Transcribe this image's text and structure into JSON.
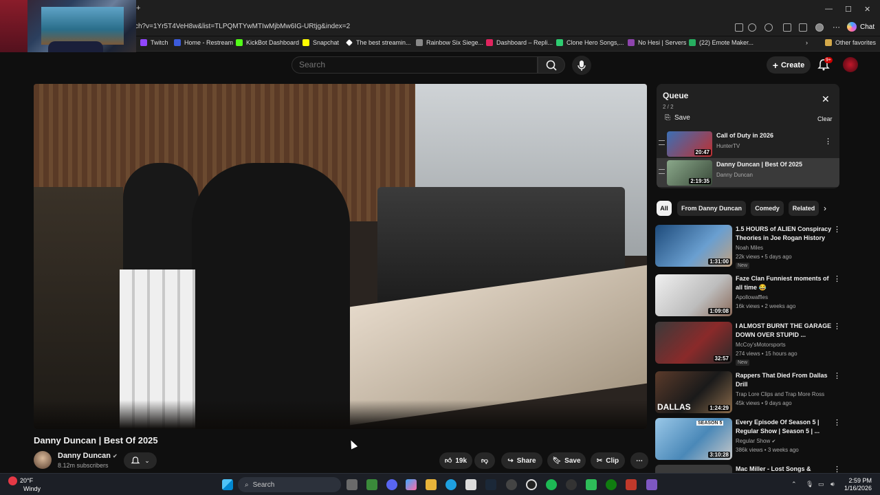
{
  "browser": {
    "url": "ch?v=1Yr5T4VeH8w&list=TLPQMTYwMTIwMjbMw6IG-URtjg&index=2",
    "chat_label": "Chat",
    "bookmarks": [
      {
        "label": "Twitch",
        "color": "#9146ff"
      },
      {
        "label": "Home - Restream",
        "color": "#3b5bdb"
      },
      {
        "label": "KickBot Dashboard",
        "color": "#53fc18"
      },
      {
        "label": "Snapchat",
        "color": "#fffc00"
      },
      {
        "label": "The best streamin...",
        "color": "#ffffff"
      },
      {
        "label": "Rainbow Six Siege...",
        "color": "#888888"
      },
      {
        "label": "Dashboard – Repli...",
        "color": "#e0245e"
      },
      {
        "label": "Clone Hero Songs,...",
        "color": "#2ecc71"
      },
      {
        "label": "No Hesi | Servers",
        "color": "#8e44ad"
      },
      {
        "label": "(22) Emote Maker...",
        "color": "#27ae60"
      }
    ],
    "other_favorites": "Other favorites"
  },
  "youtube": {
    "search_placeholder": "Search",
    "create_label": "Create",
    "notification_badge": "9+"
  },
  "video": {
    "title": "Danny Duncan | Best Of 2025",
    "channel": "Danny Duncan",
    "subscribers": "8.12m subscribers",
    "likes": "19k",
    "share_label": "Share",
    "save_label": "Save",
    "clip_label": "Clip"
  },
  "queue": {
    "title": "Queue",
    "count": "2 / 2",
    "save_label": "Save",
    "clear_label": "Clear",
    "items": [
      {
        "title": "Call of Duty in 2026",
        "channel": "HunterTV",
        "duration": "20:47",
        "thumb_color": "#3b6fb5"
      },
      {
        "title": "Danny Duncan | Best Of 2025",
        "channel": "Danny Duncan",
        "duration": "2:19:35",
        "thumb_color": "#6b8a6a"
      }
    ]
  },
  "chips": [
    "All",
    "From Danny Duncan",
    "Comedy",
    "Related"
  ],
  "recommendations": [
    {
      "title_line1": "1.5 HOURS of ALIEN Conspiracy",
      "title_line2": "Theories in Joe Rogan History",
      "channel": "Noah Miles",
      "meta": "22k views • 5 days ago",
      "badge": "New",
      "duration": "1:31:00",
      "thumb_color": "#2a5a8a"
    },
    {
      "title_line1": "Faze Clan Funniest moments of",
      "title_line2": "all time 😂",
      "channel": "Apollowaffles",
      "meta": "16k views • 2 weeks ago",
      "badge": "",
      "duration": "1:09:08",
      "thumb_color": "#d8d8d8"
    },
    {
      "title_line1": "I ALMOST BURNT THE GARAGE",
      "title_line2": "DOWN OVER STUPID ...",
      "channel": "McCoy'sMotorsports",
      "meta": "274 views • 15 hours ago",
      "badge": "New",
      "duration": "32:57",
      "thumb_color": "#7a2a2a"
    },
    {
      "title_line1": "Rappers That Died From Dallas",
      "title_line2": "Drill",
      "channel": "Trap Lore Clips and Trap More Ross",
      "meta": "45k views • 9 days ago",
      "badge": "",
      "duration": "1:24:29",
      "thumb_color": "#4a3a2a"
    },
    {
      "title_line1": "Every Episode Of Season 5 |",
      "title_line2": "Regular Show | Season 5 | ...",
      "channel": "Regular Show",
      "meta": "386k views • 3 weeks ago",
      "badge": "",
      "duration": "3:10:28",
      "thumb_color": "#6aa0c8"
    },
    {
      "title_line1": "Mac Miller - Lost Songs &",
      "title_line2": "",
      "channel": "",
      "meta": "",
      "badge": "",
      "duration": "",
      "thumb_color": "#3a3a3a"
    }
  ],
  "taskbar": {
    "temperature": "20°F",
    "weather_desc": "Windy",
    "search_label": "Search",
    "time": "2:59 PM",
    "date": "1/16/2026"
  }
}
